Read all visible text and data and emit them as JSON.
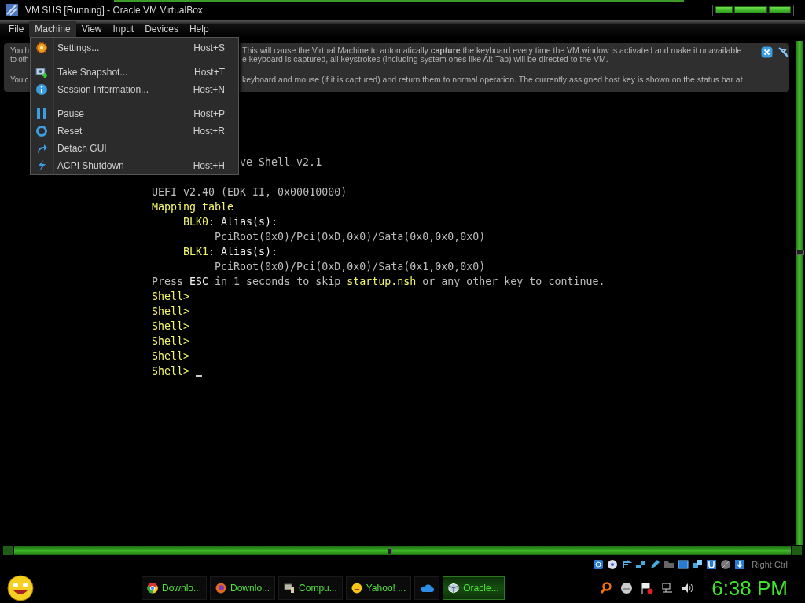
{
  "window": {
    "title": "VM SUS [Running] - Oracle VM VirtualBox"
  },
  "menubar": [
    {
      "label": "File",
      "selected": false
    },
    {
      "label": "Machine",
      "selected": true
    },
    {
      "label": "View",
      "selected": false
    },
    {
      "label": "Input",
      "selected": false
    },
    {
      "label": "Devices",
      "selected": false
    },
    {
      "label": "Help",
      "selected": false
    }
  ],
  "machine_menu": {
    "sections": [
      [
        {
          "kind": "settings",
          "label": "Settings...",
          "shortcut": "Host+S"
        }
      ],
      [
        {
          "kind": "snapshot",
          "label": "Take Snapshot...",
          "shortcut": "Host+T"
        },
        {
          "kind": "info",
          "label": "Session Information...",
          "shortcut": "Host+N"
        }
      ],
      [
        {
          "kind": "pause",
          "label": "Pause",
          "shortcut": "Host+P"
        },
        {
          "kind": "reset",
          "label": "Reset",
          "shortcut": "Host+R"
        },
        {
          "kind": "detach",
          "label": "Detach GUI"
        },
        {
          "kind": "shutdown",
          "label": "ACPI Shutdown",
          "shortcut": "Host+H"
        }
      ]
    ]
  },
  "notification": {
    "lines": [
      {
        "left": "You h",
        "right": "This will cause the Virtual Machine to automatically **capture** the keyboard every time the VM window is activated and make it unavailable"
      },
      {
        "left": "to oth",
        "right": "e keyboard is captured, all keystrokes (including system ones like Alt-Tab) will be directed to the VM."
      },
      {
        "left": "You c",
        "right": "keyboard and mouse (if it is captured) and return them to normal operation. The currently assigned host key is shown on the status bar at"
      }
    ]
  },
  "terminal": {
    "lines": [
      {
        "kind": "cut",
        "segments": [
          {
            "kind": "normal",
            "text": "ve Shell v2.1"
          }
        ]
      },
      {
        "kind": "full",
        "segments": [
          {
            "kind": "normal",
            "text": "UEFI v2.40 (EDK II, 0x00010000)"
          }
        ]
      },
      {
        "kind": "full",
        "segments": [
          {
            "kind": "highlight",
            "text": "Mapping table"
          }
        ]
      },
      {
        "kind": "full",
        "segments": [
          {
            "kind": "highlight",
            "text": "     BLK0"
          },
          {
            "kind": "bright",
            "text": ": Alias(s):"
          }
        ]
      },
      {
        "kind": "full",
        "segments": [
          {
            "kind": "normal",
            "text": "          PciRoot(0x0)/Pci(0xD,0x0)/Sata(0x0,0x0,0x0)"
          }
        ]
      },
      {
        "kind": "full",
        "segments": [
          {
            "kind": "highlight",
            "text": "     BLK1"
          },
          {
            "kind": "bright",
            "text": ": Alias(s):"
          }
        ]
      },
      {
        "kind": "full",
        "segments": [
          {
            "kind": "normal",
            "text": "          PciRoot(0x0)/Pci(0xD,0x0)/Sata(0x1,0x0,0x0)"
          }
        ]
      },
      {
        "kind": "full",
        "segments": [
          {
            "kind": "normal",
            "text": "Press "
          },
          {
            "kind": "bright",
            "text": "ESC"
          },
          {
            "kind": "normal",
            "text": " in 1 seconds to skip "
          },
          {
            "kind": "highlight",
            "text": "startup.nsh"
          },
          {
            "kind": "normal",
            "text": " or any other key to continue."
          }
        ]
      },
      {
        "kind": "full",
        "segments": [
          {
            "kind": "highlight",
            "text": "Shell>"
          }
        ]
      },
      {
        "kind": "full",
        "segments": [
          {
            "kind": "highlight",
            "text": "Shell>"
          }
        ]
      },
      {
        "kind": "full",
        "segments": [
          {
            "kind": "highlight",
            "text": "Shell>"
          }
        ]
      },
      {
        "kind": "full",
        "segments": [
          {
            "kind": "highlight",
            "text": "Shell>"
          }
        ]
      },
      {
        "kind": "full",
        "segments": [
          {
            "kind": "highlight",
            "text": "Shell>"
          }
        ]
      },
      {
        "kind": "prompt",
        "segments": [
          {
            "kind": "highlight",
            "text": "Shell>"
          }
        ]
      }
    ]
  },
  "status_bar": {
    "host_key": "Right Ctrl"
  },
  "taskbar": {
    "tasks": [
      {
        "kind": "chrome",
        "label": "Downlo...",
        "selected": false
      },
      {
        "kind": "firefox",
        "label": "Downlo...",
        "selected": false
      },
      {
        "kind": "computer",
        "label": "Compu...",
        "selected": false
      },
      {
        "kind": "yahoo",
        "label": "Yahoo! ...",
        "selected": false
      },
      {
        "kind": "cloud",
        "selected": false
      },
      {
        "kind": "cube",
        "label": "Oracle...",
        "selected": true
      }
    ],
    "clock": "6:38 PM"
  }
}
